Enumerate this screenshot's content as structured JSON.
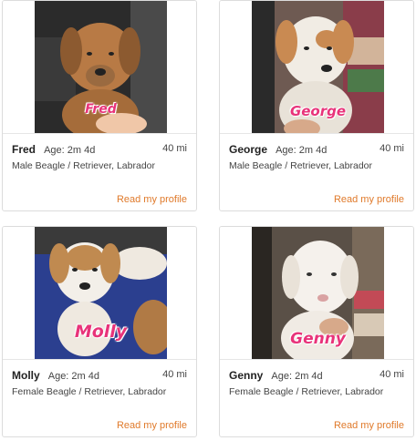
{
  "cards": [
    {
      "name": "Fred",
      "overlay_name": "Fred",
      "age": "Age: 2m 4d",
      "distance": "40 mi",
      "breed": "Male Beagle / Retriever, Labrador",
      "link": "Read my profile",
      "fur_color": "#b87a45",
      "bg_color": "#2b2b2b"
    },
    {
      "name": "George",
      "overlay_name": "George",
      "age": "Age: 2m 4d",
      "distance": "40 mi",
      "breed": "Male Beagle / Retriever, Labrador",
      "link": "Read my profile",
      "fur_color": "#f1ece4",
      "bg_color": "#6e5a52"
    },
    {
      "name": "Molly",
      "overlay_name": "Molly",
      "age": "Age: 2m 4d",
      "distance": "40 mi",
      "breed": "Female Beagle / Retriever, Labrador",
      "link": "Read my profile",
      "fur_color": "#f3efe9",
      "bg_color": "#2b3f8f"
    },
    {
      "name": "Genny",
      "overlay_name": "Genny",
      "age": "Age: 2m 4d",
      "distance": "40 mi",
      "breed": "Female Beagle / Retriever, Labrador",
      "link": "Read my profile",
      "fur_color": "#f5f1ec",
      "bg_color": "#5a5047"
    }
  ],
  "colors": {
    "accent_link": "#e07a2b",
    "overlay_pink": "#e8337a",
    "card_border": "#dcdcdc"
  }
}
